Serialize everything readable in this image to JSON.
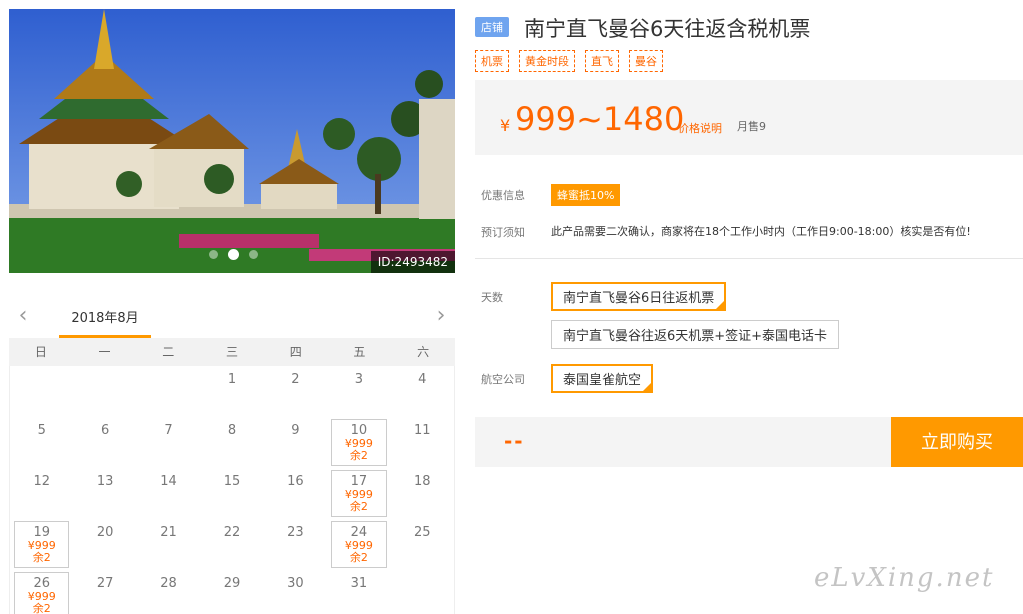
{
  "photo": {
    "id_label": "ID:2493482",
    "slide_count": 3,
    "active_slide": 2
  },
  "calendar": {
    "month_label": "2018年8月",
    "weekdays": [
      "日",
      "一",
      "二",
      "三",
      "四",
      "五",
      "六"
    ],
    "first_weekday_index": 3,
    "days_in_month": 31,
    "available": {
      "10": {
        "price": "¥999",
        "remain": "余2"
      },
      "17": {
        "price": "¥999",
        "remain": "余2"
      },
      "19": {
        "price": "¥999",
        "remain": "余2"
      },
      "24": {
        "price": "¥999",
        "remain": "余2"
      },
      "26": {
        "price": "¥999",
        "remain": "余2"
      }
    }
  },
  "product": {
    "shop_badge": "店铺",
    "title": "南宁直飞曼谷6天往返含税机票",
    "tags": [
      "机票",
      "黄金时段",
      "直飞",
      "曼谷"
    ]
  },
  "price": {
    "currency": "¥",
    "range": "999~1480",
    "note_link": "价格说明",
    "sold": "月售9"
  },
  "info": {
    "promo_label": "优惠信息",
    "promo_badge": "蜂蜜抵10%",
    "notice_label": "预订须知",
    "notice_text": "此产品需要二次确认，商家将在18个工作小时内（工作日9:00-18:00）核实是否有位!"
  },
  "options": {
    "days_label": "天数",
    "days": [
      {
        "label": "南宁直飞曼谷6日往返机票",
        "selected": true
      },
      {
        "label": "南宁直飞曼谷往返6天机票+签证+泰国电话卡",
        "selected": false
      }
    ],
    "airline_label": "航空公司",
    "airlines": [
      {
        "label": "泰国皇雀航空",
        "selected": true
      }
    ]
  },
  "buy": {
    "price_placeholder": "--",
    "button_label": "立即购买"
  },
  "watermark": "eLvXing.net",
  "colors": {
    "accent": "#ff9900",
    "price": "#ff6600",
    "shop_badge": "#6fa4ef"
  }
}
